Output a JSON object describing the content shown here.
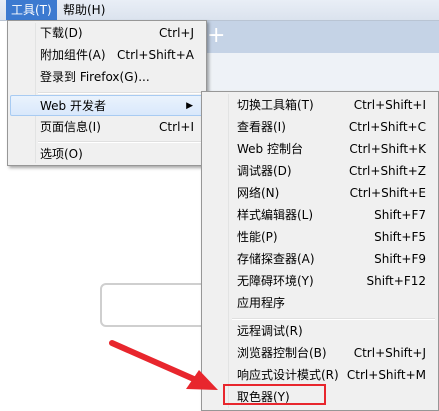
{
  "menubar": {
    "tools": "工具(T)",
    "help": "帮助(H)"
  },
  "tabstrip": {
    "newtab_glyph": "+"
  },
  "tools_menu": {
    "items": [
      {
        "label": "下载(D)",
        "shortcut": "Ctrl+J"
      },
      {
        "label": "附加组件(A)",
        "shortcut": "Ctrl+Shift+A"
      },
      {
        "label": "登录到 Firefox(G)...",
        "shortcut": ""
      },
      {
        "label": "Web 开发者",
        "shortcut": ""
      },
      {
        "label": "页面信息(I)",
        "shortcut": "Ctrl+I"
      },
      {
        "label": "选项(O)",
        "shortcut": ""
      }
    ]
  },
  "dev_menu": {
    "items": [
      {
        "label": "切换工具箱(T)",
        "shortcut": "Ctrl+Shift+I"
      },
      {
        "label": "查看器(I)",
        "shortcut": "Ctrl+Shift+C"
      },
      {
        "label": "Web 控制台",
        "shortcut": "Ctrl+Shift+K"
      },
      {
        "label": "调试器(D)",
        "shortcut": "Ctrl+Shift+Z"
      },
      {
        "label": "网络(N)",
        "shortcut": "Ctrl+Shift+E"
      },
      {
        "label": "样式编辑器(L)",
        "shortcut": "Shift+F7"
      },
      {
        "label": "性能(P)",
        "shortcut": "Shift+F5"
      },
      {
        "label": "存储探查器(A)",
        "shortcut": "Shift+F9"
      },
      {
        "label": "无障碍环境(Y)",
        "shortcut": "Shift+F12"
      },
      {
        "label": "应用程序",
        "shortcut": ""
      },
      {
        "label": "远程调试(R)",
        "shortcut": ""
      },
      {
        "label": "浏览器控制台(B)",
        "shortcut": "Ctrl+Shift+J"
      },
      {
        "label": "响应式设计模式(R)",
        "shortcut": "Ctrl+Shift+M"
      },
      {
        "label": "取色器(Y)",
        "shortcut": ""
      }
    ]
  },
  "colors": {
    "highlight_border": "#a8cbf2",
    "annotation_red": "#e8262d",
    "menubar_active": "#3c7ad0"
  }
}
